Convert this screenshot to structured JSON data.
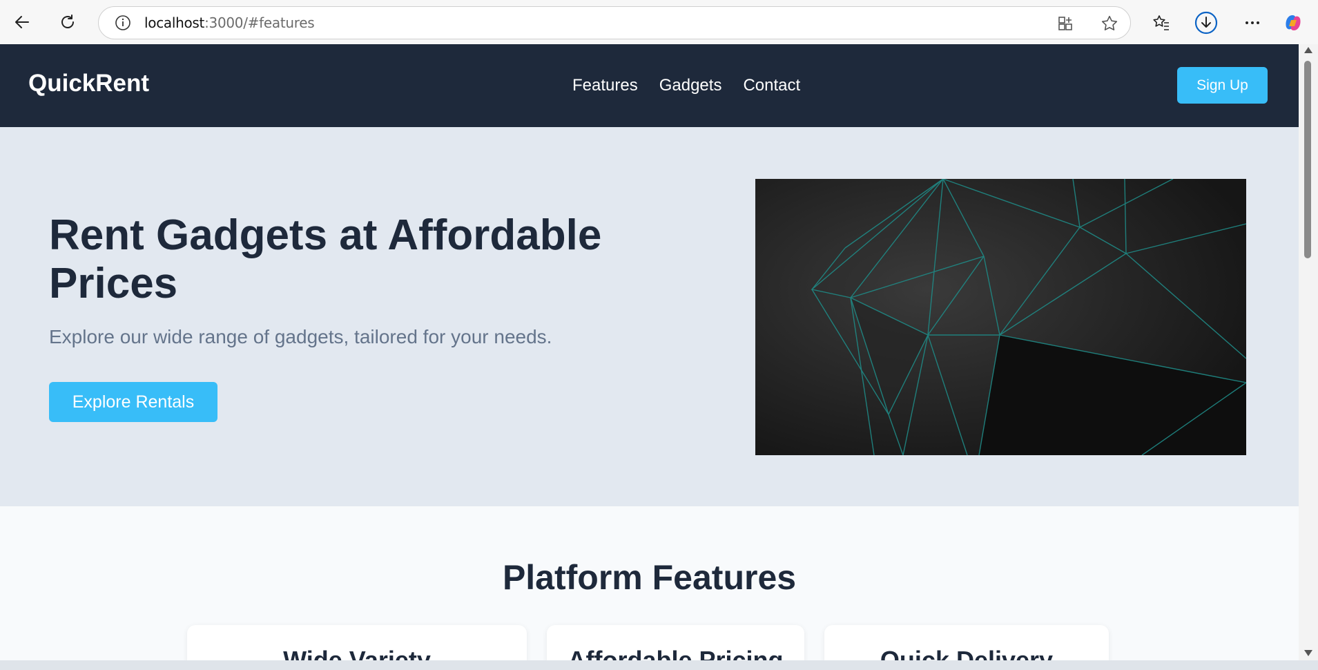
{
  "browser": {
    "url_host": "localhost",
    "url_rest": ":3000/#features"
  },
  "header": {
    "logo": "QuickRent",
    "nav": [
      "Features",
      "Gadgets",
      "Contact"
    ],
    "signup_label": "Sign Up"
  },
  "hero": {
    "title": "Rent Gadgets at Affordable Prices",
    "subtitle": "Explore our wide range of gadgets, tailored for your needs.",
    "cta_label": "Explore Rentals"
  },
  "features": {
    "title": "Platform Features",
    "cards": [
      {
        "title": "Wide Variety"
      },
      {
        "title": "Affordable Pricing"
      },
      {
        "title": "Quick Delivery"
      }
    ]
  },
  "colors": {
    "header_bg": "#1e293b",
    "accent": "#38bdf8",
    "hero_bg": "#e2e8f0",
    "heading_text": "#1e293b",
    "muted_text": "#64748b"
  }
}
